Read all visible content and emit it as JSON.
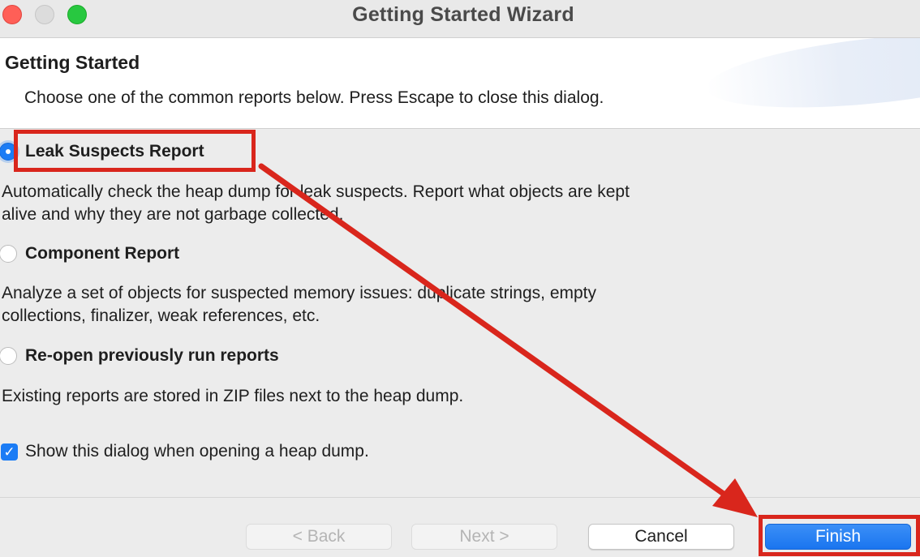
{
  "window": {
    "title": "Getting Started Wizard"
  },
  "header": {
    "title": "Getting Started",
    "description": "Choose one of the common reports below. Press Escape to close this dialog."
  },
  "options": [
    {
      "label": "Leak Suspects Report",
      "selected": true,
      "description_lines": [
        "Automatically check the heap dump for leak suspects. Report what objects are kept",
        "alive and why they are not garbage collected."
      ]
    },
    {
      "label": "Component Report",
      "selected": false,
      "description_lines": [
        "Analyze a set of objects for suspected memory issues: duplicate strings, empty",
        "collections, finalizer, weak references, etc."
      ]
    },
    {
      "label": "Re-open previously run reports",
      "selected": false,
      "description_lines": [
        "Existing reports are stored in ZIP files next to the heap dump."
      ]
    }
  ],
  "show_dialog_checkbox": {
    "label": "Show this dialog when opening a heap dump.",
    "checked": true
  },
  "buttons": {
    "back": "< Back",
    "next": "Next >",
    "cancel": "Cancel",
    "finish": "Finish"
  },
  "colors": {
    "accent": "#1b7cf5",
    "annotation": "#d9261c",
    "close_light": "#ff5f57",
    "maximize_light": "#28c840"
  },
  "icons": {
    "selected_radio": "radio-checked-icon",
    "checkbox": "checkmark-icon",
    "annotation_arrow": "red-arrow-icon"
  }
}
